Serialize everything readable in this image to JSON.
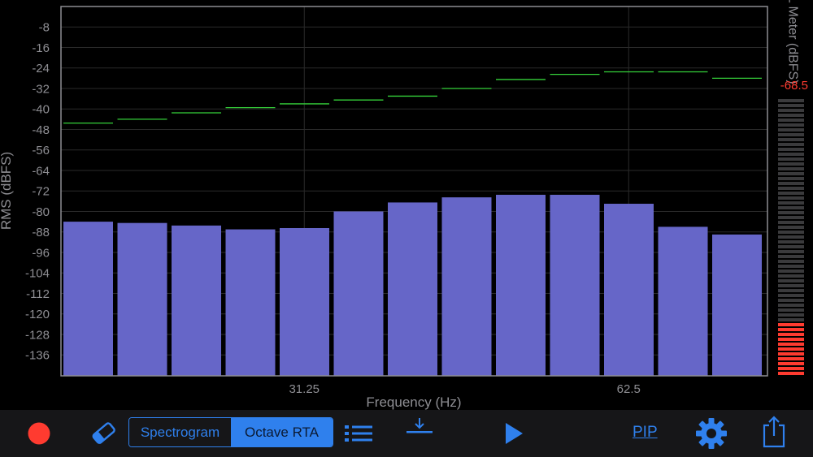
{
  "chart_data": {
    "type": "bar",
    "y_ticks": [
      "-8",
      "-16",
      "-24",
      "-32",
      "-40",
      "-48",
      "-56",
      "-64",
      "-72",
      "-80",
      "-88",
      "-96",
      "-104",
      "-112",
      "-120",
      "-128",
      "-136"
    ],
    "ylim": [
      -144,
      0
    ],
    "ylabel": "RMS (dBFS)",
    "xlabel": "Frequency (Hz)",
    "x_ticks": [
      {
        "label": "31.25",
        "band_pos": 4.5
      },
      {
        "label": "62.5",
        "band_pos": 10.5
      }
    ],
    "bands": 13,
    "values": [
      -84,
      -84.5,
      -85.5,
      -87,
      -86.5,
      -80,
      -76.5,
      -74.5,
      -73.5,
      -73.5,
      -77,
      -86,
      -89
    ],
    "peak_values": [
      -45.5,
      -44,
      -41.5,
      -39.5,
      -38,
      -36.5,
      -35,
      -32,
      -28.5,
      -26.5,
      -25.5,
      -25.5,
      -28
    ],
    "colors": {
      "bar": "#6666c8",
      "peak": "#35d13a",
      "grid": "#2a2a2a"
    }
  },
  "spl_meter": {
    "label": "SPL Meter (dBFS)",
    "value": "-68.5",
    "level_fraction": 0.2,
    "value_color": "#ff3b30"
  },
  "toolbar": {
    "spectrogram_label": "Spectrogram",
    "octave_rta_label": "Octave RTA",
    "pip_label": "PIP",
    "accent": "#2f80ed"
  }
}
